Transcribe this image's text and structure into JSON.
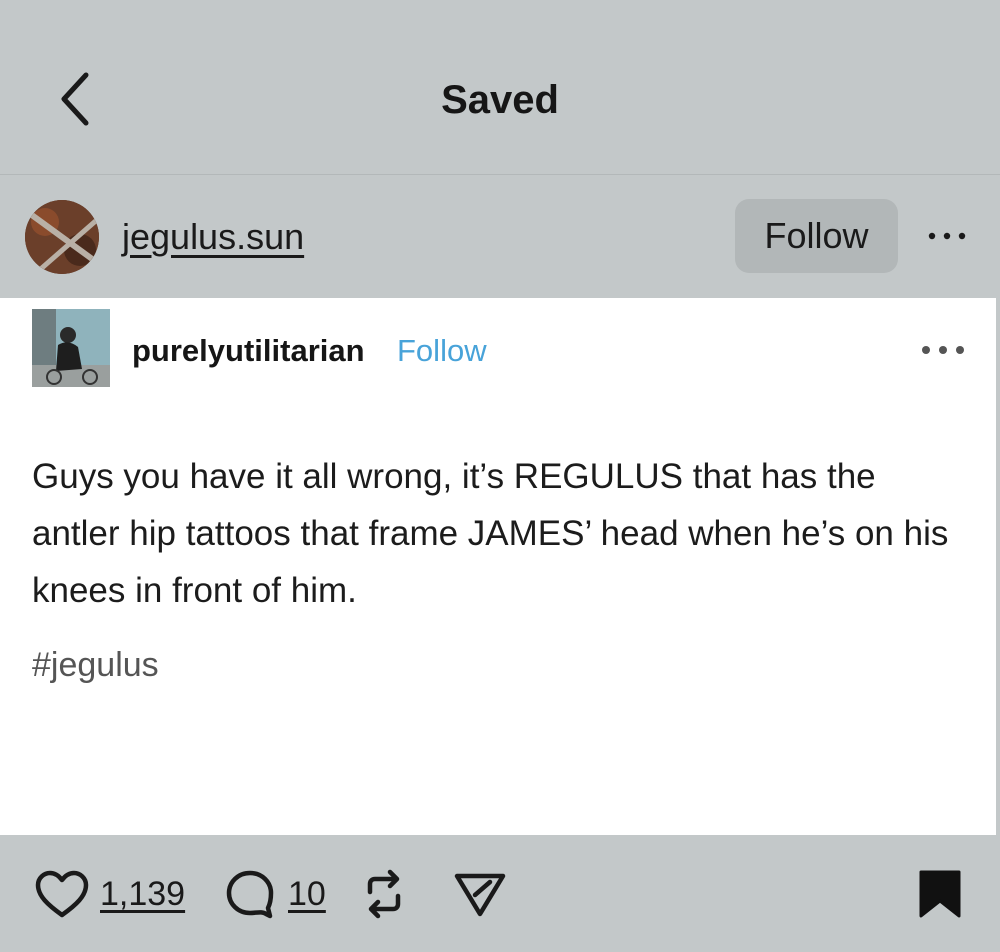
{
  "header": {
    "title": "Saved"
  },
  "post": {
    "author": "jegulus.sun",
    "follow_label": "Follow"
  },
  "reblog": {
    "author": "purelyutilitarian",
    "follow_label": "Follow",
    "body": "Guys you have it all wrong, it’s REGULUS that has the antler hip tattoos that frame JAMES’ head when he’s on his knees in front of him.",
    "tag": "#jegulus"
  },
  "actions": {
    "likes": "1,139",
    "comments": "10"
  },
  "colors": {
    "background": "#c3c8c9",
    "follow_link": "#48a3d9"
  }
}
